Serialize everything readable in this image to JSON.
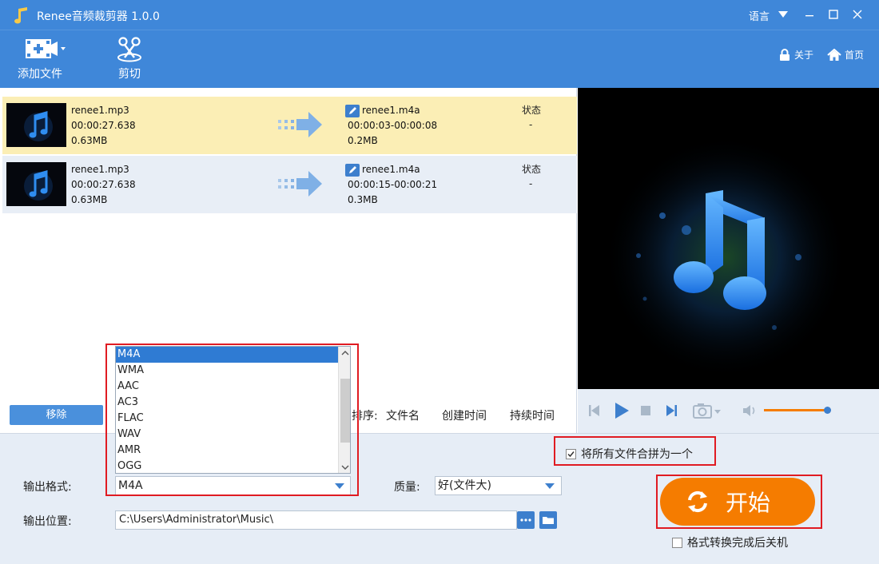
{
  "window": {
    "title": "Renee音频裁剪器 1.0.0",
    "language_label": "语言"
  },
  "toolbar": {
    "add_file_label": "添加文件",
    "cut_label": "剪切",
    "about_label": "关于",
    "home_label": "首页"
  },
  "files": [
    {
      "src_name": "renee1.mp3",
      "src_duration": "00:00:27.638",
      "src_size": "0.63MB",
      "dst_name": "renee1.m4a",
      "dst_range": "00:00:03-00:00:08",
      "dst_size": "0.2MB",
      "status_label": "状态",
      "status_value": "-"
    },
    {
      "src_name": "renee1.mp3",
      "src_duration": "00:00:27.638",
      "src_size": "0.63MB",
      "dst_name": "renee1.m4a",
      "dst_range": "00:00:15-00:00:21",
      "dst_size": "0.3MB",
      "status_label": "状态",
      "status_value": "-"
    }
  ],
  "list_actions": {
    "remove_label": "移除",
    "sort_label": "排序:",
    "sort_options": [
      "文件名",
      "创建时间",
      "持续时间"
    ]
  },
  "output": {
    "format_label": "输出格式:",
    "format_value": "M4A",
    "format_options": [
      "M4A",
      "WMA",
      "AAC",
      "AC3",
      "FLAC",
      "WAV",
      "AMR",
      "OGG"
    ],
    "quality_label": "质量:",
    "quality_value": "好(文件大)",
    "location_label": "输出位置:",
    "location_value": "C:\\Users\\Administrator\\Music\\"
  },
  "merge_label": "将所有文件合拼为一个",
  "start_label": "开始",
  "shutdown_label": "格式转换完成后关机",
  "player": {
    "volume_fraction": 0.94
  },
  "colors": {
    "titlebar": "#3f87d9",
    "start_button": "#f57c00",
    "selected_row": "#fbeeb5",
    "highlight_box": "#e01b22"
  }
}
